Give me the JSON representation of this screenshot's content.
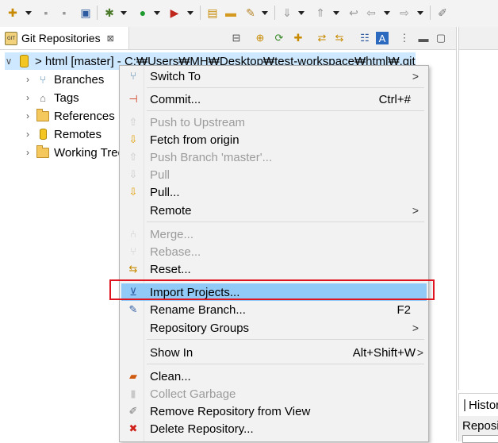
{
  "view": {
    "tab_title": "Git Repositories",
    "tab_icon_text": "GIT",
    "close_glyph": "⊠"
  },
  "tree": {
    "root": {
      "label": "> html [master] - C:₩Users₩MH₩Desktop₩test-workspace₩html₩.git",
      "expanded": true
    },
    "children": [
      {
        "label": "Branches",
        "icon": "branches-icon"
      },
      {
        "label": "Tags",
        "icon": "tags-icon"
      },
      {
        "label": "References",
        "icon": "folder-icon"
      },
      {
        "label": "Remotes",
        "icon": "remotes-icon"
      },
      {
        "label": "Working Tree",
        "icon": "folder-icon"
      }
    ]
  },
  "right_panel": {
    "history_tab": "History",
    "repository_label": "Repository"
  },
  "menu": {
    "items": [
      {
        "label": "Switch To",
        "accel": "",
        "submenu": true,
        "disabled": false,
        "icon": "switch-icon"
      },
      {
        "label": "Commit...",
        "accel": "Ctrl+#",
        "submenu": false,
        "disabled": false,
        "icon": "commit-icon"
      },
      {
        "label": "Push to Upstream",
        "accel": "",
        "submenu": false,
        "disabled": true,
        "icon": "push-icon"
      },
      {
        "label": "Fetch from origin",
        "accel": "",
        "submenu": false,
        "disabled": false,
        "icon": "fetch-icon"
      },
      {
        "label": "Push Branch 'master'...",
        "accel": "",
        "submenu": false,
        "disabled": true,
        "icon": "push-branch-icon"
      },
      {
        "label": "Pull",
        "accel": "",
        "submenu": false,
        "disabled": true,
        "icon": "pull-icon"
      },
      {
        "label": "Pull...",
        "accel": "",
        "submenu": false,
        "disabled": false,
        "icon": "pull-dialog-icon"
      },
      {
        "label": "Remote",
        "accel": "",
        "submenu": true,
        "disabled": false,
        "icon": ""
      },
      {
        "label": "Merge...",
        "accel": "",
        "submenu": false,
        "disabled": true,
        "icon": "merge-icon"
      },
      {
        "label": "Rebase...",
        "accel": "",
        "submenu": false,
        "disabled": true,
        "icon": "rebase-icon"
      },
      {
        "label": "Reset...",
        "accel": "",
        "submenu": false,
        "disabled": false,
        "icon": "reset-icon"
      },
      {
        "label": "Import Projects...",
        "accel": "",
        "submenu": false,
        "disabled": false,
        "icon": "import-icon",
        "highlighted": true
      },
      {
        "label": "Rename Branch...",
        "accel": "F2",
        "submenu": false,
        "disabled": false,
        "icon": "rename-icon"
      },
      {
        "label": "Repository Groups",
        "accel": "",
        "submenu": true,
        "disabled": false,
        "icon": ""
      },
      {
        "label": "Show In",
        "accel": "Alt+Shift+W",
        "submenu": true,
        "disabled": false,
        "icon": ""
      },
      {
        "label": "Clean...",
        "accel": "",
        "submenu": false,
        "disabled": false,
        "icon": "clean-icon"
      },
      {
        "label": "Collect Garbage",
        "accel": "",
        "submenu": false,
        "disabled": true,
        "icon": "garbage-icon"
      },
      {
        "label": "Remove Repository from View",
        "accel": "",
        "submenu": false,
        "disabled": false,
        "icon": "remove-icon"
      },
      {
        "label": "Delete Repository...",
        "accel": "",
        "submenu": false,
        "disabled": false,
        "icon": "delete-icon"
      }
    ],
    "submenu_glyph": ">"
  },
  "colors": {
    "selection": "#cde8ff",
    "menu_highlight": "#91c9f7",
    "annotation_box": "#e0141e"
  }
}
